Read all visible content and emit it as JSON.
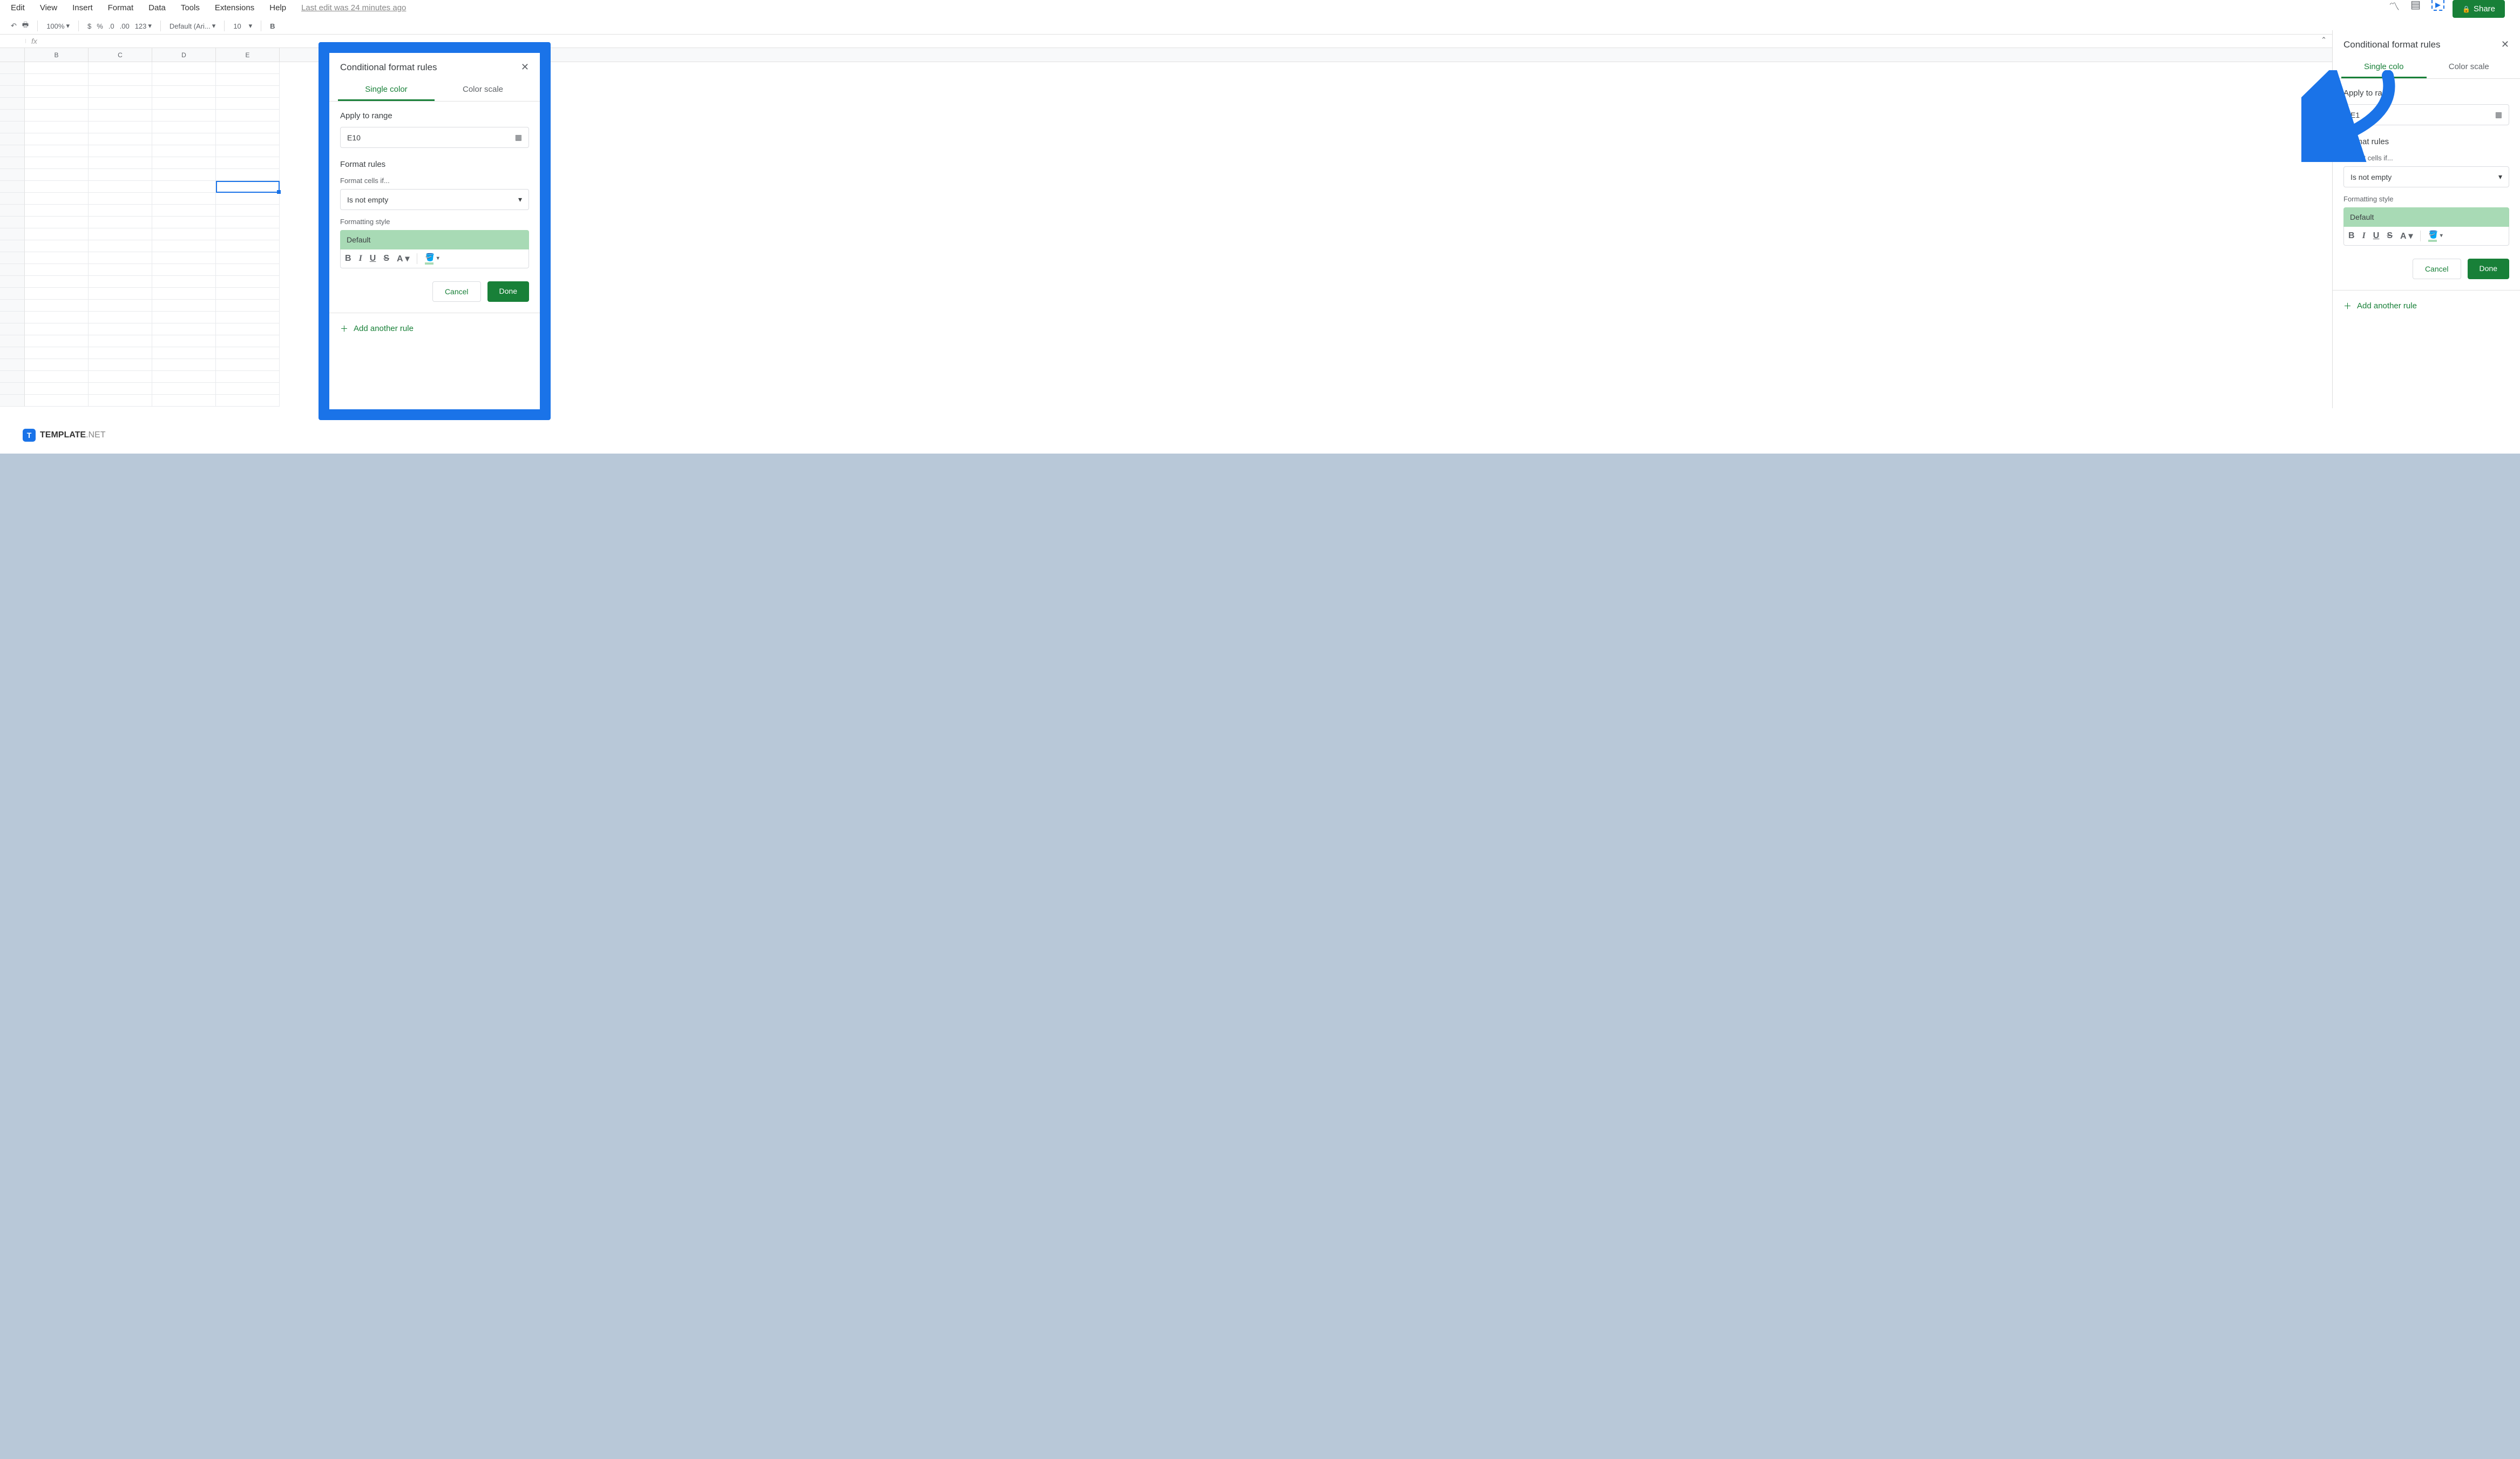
{
  "menu": {
    "edit": "Edit",
    "view": "View",
    "insert": "Insert",
    "format": "Format",
    "data": "Data",
    "tools": "Tools",
    "extensions": "Extensions",
    "help": "Help",
    "last_edit": "Last edit was 24 minutes ago"
  },
  "share": "Share",
  "toolbar": {
    "zoom": "100%",
    "font": "Default (Ari...",
    "size": "10",
    "currency": "$",
    "percent": "%",
    "dec_dec": ".0",
    "dec_inc": ".00",
    "num_fmt": "123"
  },
  "fx": "fx",
  "columns": [
    "B",
    "C",
    "D",
    "E"
  ],
  "panel": {
    "title": "Conditional format rules",
    "tab1": "Single color",
    "tab2": "Color scale",
    "apply_label": "Apply to range",
    "range": "E10",
    "rules_label": "Format rules",
    "format_if_label": "Format cells if...",
    "format_if": "Is not empty",
    "style_label": "Formatting style",
    "style_preview": "Default",
    "cancel": "Cancel",
    "done": "Done",
    "add_rule": "Add another rule"
  },
  "side": {
    "title": "Conditional format rules",
    "tab1_short": "Single colo",
    "apply_label_short": "Apply to ran",
    "range_short": "E1"
  },
  "watermark": {
    "brand": "TEMPLATE",
    "suffix": ".NET"
  }
}
